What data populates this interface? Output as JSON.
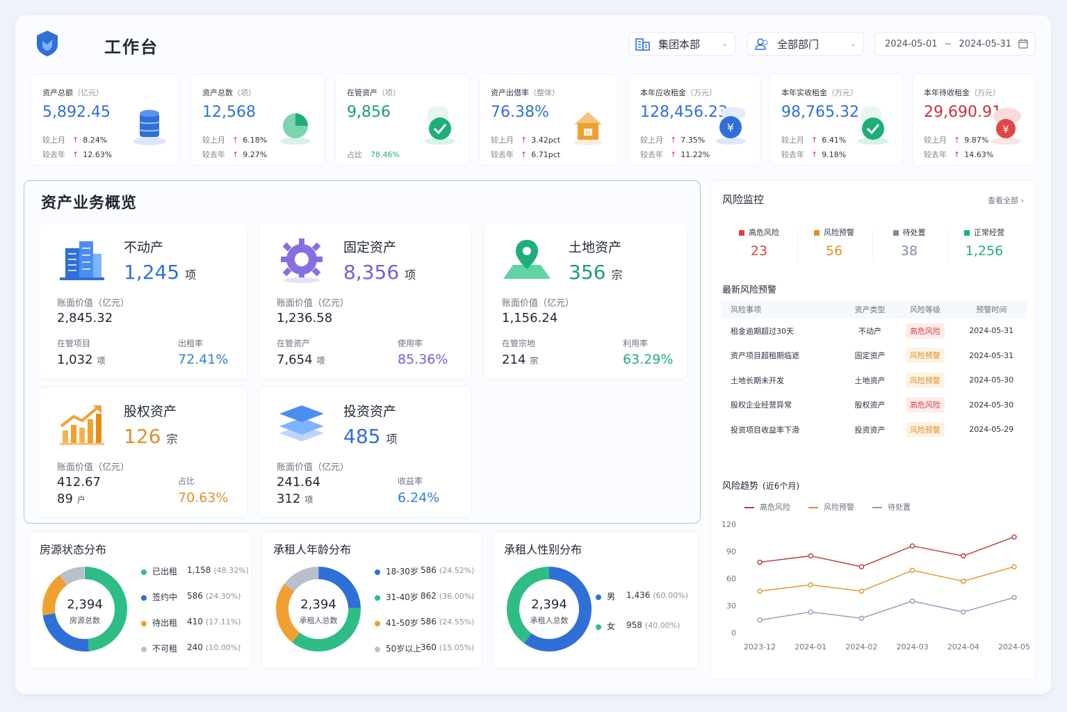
{
  "header": {
    "title": "工作台",
    "org": "集团本部",
    "dept": "全部部门",
    "date_from": "2024-05-01",
    "date_sep": "~",
    "date_to": "2024-05-31"
  },
  "kpis": [
    {
      "label": "资产总额",
      "unit": "（亿元）",
      "value": "5,892.45",
      "color": "#2f6fd8",
      "r1_label": "较上月",
      "r1": "8.24%",
      "r2_label": "较去年",
      "r2": "12.63%",
      "icon": "database-icon"
    },
    {
      "label": "资产总数",
      "unit": "（项）",
      "value": "12,568",
      "color": "#2f6fd8",
      "r1_label": "较上月",
      "r1": "6.18%",
      "r2_label": "较去年",
      "r2": "9.27%",
      "icon": "pie-chart-icon"
    },
    {
      "label": "在管资产",
      "unit": "（项）",
      "value": "9,856",
      "color": "#1f9d6e",
      "share_label": "占比",
      "share": "78.46%",
      "icon": "check-icon"
    },
    {
      "label": "资产出借率",
      "unit": "（整体）",
      "value": "76.38%",
      "color": "#2f6fd8",
      "r1_label": "较上月",
      "r1": "3.42pct",
      "r2_label": "较去年",
      "r2": "6.71pct",
      "icon": "house-icon"
    },
    {
      "label": "本年应收租金",
      "unit": "（万元）",
      "value": "128,456.23",
      "color": "#2f6fd8",
      "r1_label": "较上月",
      "r1": "7.35%",
      "r2_label": "较去年",
      "r2": "11.22%",
      "icon": "yen-icon"
    },
    {
      "label": "本年实收租金",
      "unit": "（万元）",
      "value": "98,765.32",
      "color": "#2f6fd8",
      "r1_label": "较上月",
      "r1": "6.41%",
      "r2_label": "较去年",
      "r2": "9.18%",
      "icon": "check-icon"
    },
    {
      "label": "本年待收租金",
      "unit": "（万元）",
      "value": "29,690.91",
      "color": "#c8323a",
      "r1_label": "较上月",
      "r1": "9.87%",
      "r2_label": "较去年",
      "r2": "14.63%",
      "icon": "yen-red-icon"
    }
  ],
  "overview": {
    "title": "资产业务概览",
    "cards": [
      {
        "name": "不动产",
        "count": "1,245",
        "unit": "项",
        "color": "#2f6fd8",
        "bv_label": "账面价值（亿元）",
        "bv": "2,845.32",
        "s1_label": "在管项目",
        "s1": "1,032",
        "s1_unit": "项",
        "s2_label": "出租率",
        "s2": "72.41%",
        "s2_color": "#2f7fd8",
        "icon": "building-icon"
      },
      {
        "name": "固定资产",
        "count": "8,356",
        "unit": "项",
        "color": "#7b5bd6",
        "bv_label": "账面价值（亿元）",
        "bv": "1,236.58",
        "s1_label": "在管资产",
        "s1": "7,654",
        "s1_unit": "项",
        "s2_label": "使用率",
        "s2": "85.36%",
        "s2_color": "#7b5bd6",
        "icon": "gear-icon"
      },
      {
        "name": "土地资产",
        "count": "356",
        "unit": "宗",
        "color": "#1f9d6e",
        "bv_label": "账面价值（亿元）",
        "bv": "1,156.24",
        "s1_label": "在管宗地",
        "s1": "214",
        "s1_unit": "宗",
        "s2_label": "利用率",
        "s2": "63.29%",
        "s2_color": "#1fae7a",
        "icon": "map-pin-icon"
      },
      {
        "name": "股权资产",
        "count": "126",
        "unit": "宗",
        "color": "#e0902a",
        "bv_label": "账面价值（亿元）",
        "bv": "412.67",
        "s1_label": "",
        "s1": "89",
        "s1_unit": "户",
        "s2_label": "占比",
        "s2": "70.63%",
        "s2_color": "#e0902a",
        "icon": "growth-chart-icon"
      },
      {
        "name": "投资资产",
        "count": "485",
        "unit": "项",
        "color": "#2f6fd8",
        "bv_label": "账面价值（亿元）",
        "bv": "241.64",
        "s1_label": "",
        "s1": "312",
        "s1_unit": "项",
        "s2_label": "收益率",
        "s2": "6.24%",
        "s2_color": "#2f7fd8",
        "icon": "layers-icon"
      }
    ]
  },
  "distributions": [
    {
      "title": "房源状态分布",
      "total": "2,394",
      "total_label": "房源总数",
      "items": [
        {
          "name": "已出租",
          "count": "1,158",
          "pct": "(48.32%)",
          "value": 48.32,
          "color": "#2ebd85"
        },
        {
          "name": "签约中",
          "count": "586",
          "pct": "(24.30%)",
          "value": 24.3,
          "color": "#2f6fd8"
        },
        {
          "name": "待出租",
          "count": "410",
          "pct": "(17.11%)",
          "value": 17.11,
          "color": "#f0a030"
        },
        {
          "name": "不可租",
          "count": "240",
          "pct": "(10.00%)",
          "value": 10.0,
          "color": "#b8c0cc"
        }
      ]
    },
    {
      "title": "承租人年龄分布",
      "total": "2,394",
      "total_label": "承租人总数",
      "items": [
        {
          "name": "18-30岁",
          "count": "586",
          "pct": "(24.52%)",
          "value": 24.52,
          "color": "#2f6fd8"
        },
        {
          "name": "31-40岁",
          "count": "862",
          "pct": "(36.00%)",
          "value": 36.0,
          "color": "#2ebd85"
        },
        {
          "name": "41-50岁",
          "count": "586",
          "pct": "(24.55%)",
          "value": 24.55,
          "color": "#f0a030"
        },
        {
          "name": "50岁以上",
          "count": "360",
          "pct": "(15.05%)",
          "value": 15.05,
          "color": "#b8c0cc"
        }
      ]
    },
    {
      "title": "承租人性别分布",
      "total": "2,394",
      "total_label": "承租人总数",
      "items": [
        {
          "name": "男",
          "count": "1,436",
          "pct": "(60.00%)",
          "value": 60.0,
          "color": "#2f6fd8"
        },
        {
          "name": "女",
          "count": "958",
          "pct": "(40.00%)",
          "value": 40.0,
          "color": "#2ebd85"
        }
      ]
    }
  ],
  "risk": {
    "title": "风险监控",
    "more": "查看全部",
    "stats": [
      {
        "label": "高危风险",
        "value": "23",
        "color": "#d94141"
      },
      {
        "label": "风险预警",
        "value": "56",
        "color": "#e0902a"
      },
      {
        "label": "待处置",
        "value": "38",
        "color": "#7d8aa3"
      },
      {
        "label": "正常经营",
        "value": "1,256",
        "color": "#1fae7a"
      }
    ],
    "latest_title": "最新风险预警",
    "columns": [
      "风险事项",
      "资产类型",
      "风险等级",
      "预警时间"
    ],
    "rows": [
      {
        "item": "租金逾期超过30天",
        "type": "不动产",
        "level": "高危风险",
        "lvl": "hi",
        "date": "2024-05-31"
      },
      {
        "item": "资产项目超租期临遮",
        "type": "固定资产",
        "level": "风险预警",
        "lvl": "wa",
        "date": "2024-05-31"
      },
      {
        "item": "土地长期未开发",
        "type": "土地资产",
        "level": "风险预警",
        "lvl": "wa",
        "date": "2024-05-30"
      },
      {
        "item": "股权企业经营异常",
        "type": "股权资产",
        "level": "高危风险",
        "lvl": "hi",
        "date": "2024-05-30"
      },
      {
        "item": "投资项目收益率下滑",
        "type": "投资资产",
        "level": "风险预警",
        "lvl": "wa",
        "date": "2024-05-29"
      }
    ],
    "trend_title": "风险趋势",
    "trend_sub": "(近6个月)"
  },
  "chart_data": {
    "type": "line",
    "x": [
      "2023-12",
      "2024-01",
      "2024-02",
      "2024-03",
      "2024-04",
      "2024-05"
    ],
    "ylim": [
      0,
      120
    ],
    "yticks": [
      0,
      30,
      60,
      90,
      120
    ],
    "grid": false,
    "legend": "top-left",
    "series": [
      {
        "name": "高危风险",
        "color": "#b83a3a",
        "values": [
          78,
          85,
          73,
          96,
          85,
          106
        ]
      },
      {
        "name": "风险预警",
        "color": "#e0902a",
        "values": [
          46,
          53,
          46,
          69,
          57,
          73
        ]
      },
      {
        "name": "待处置",
        "color": "#8d9ab5",
        "values": [
          14,
          23,
          16,
          35,
          23,
          39
        ]
      }
    ]
  }
}
